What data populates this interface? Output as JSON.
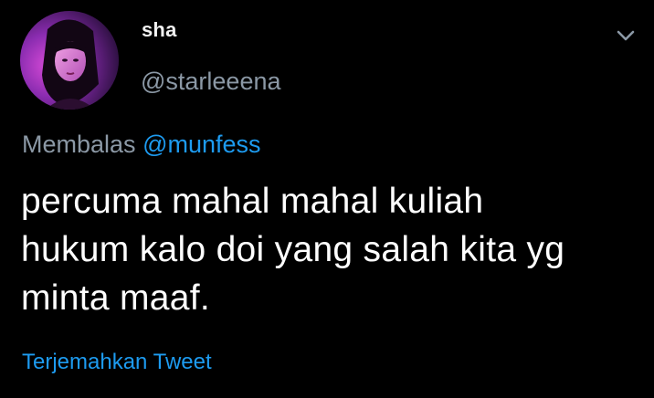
{
  "tweet": {
    "author": {
      "display_name": "sha",
      "handle": "@starleeena"
    },
    "reply": {
      "prefix": "Membalas",
      "mention": "@munfess"
    },
    "text_lines": [
      "percuma mahal mahal kuliah",
      "hukum kalo doi yang salah kita yg",
      "minta maaf."
    ],
    "translate_label": "Terjemahkan Tweet",
    "more_icon": "chevron-down-icon"
  },
  "colors": {
    "background": "#000000",
    "primary_text": "#ffffff",
    "secondary_text": "#8b98a5",
    "link": "#1d9bf0"
  }
}
